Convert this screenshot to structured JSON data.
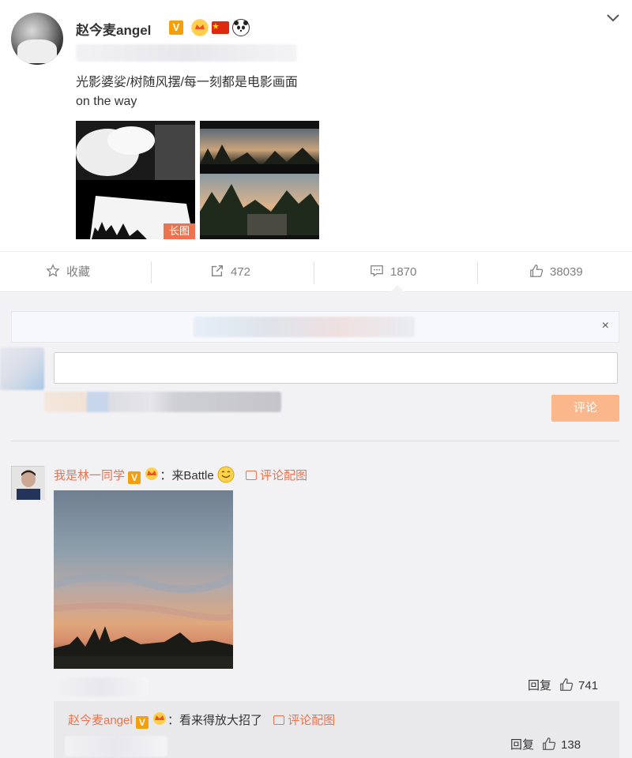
{
  "post": {
    "author": "赵今麦angel",
    "verified_badge": "V",
    "flag_icon": "china-flag-icon",
    "panda_icon": "panda-icon",
    "line1": "光影婆娑/树随风摆/每一刻都是电影画面",
    "line2": "on the way",
    "long_image_tag": "长图",
    "menu_icon": "chevron-down-icon"
  },
  "actions": {
    "favorite_label": "收藏",
    "repost_count": "472",
    "comment_count": "1870",
    "like_count": "38039"
  },
  "comment_box": {
    "close_label": "×",
    "submit_label": "评论"
  },
  "comments": [
    {
      "user": "我是林一同学",
      "badge": "V",
      "text": "：来Battle",
      "pic_link": "评论配图",
      "reply_label": "回复",
      "likes": "741"
    }
  ],
  "reply": {
    "user": "赵今麦angel",
    "badge": "V",
    "text": "：看来得放大招了",
    "pic_link": "评论配图",
    "reply_label": "回复",
    "likes": "138"
  },
  "colors": {
    "accent": "#eb7350",
    "submit_bg": "#fab78b",
    "verified": "#f59f0a",
    "panel_bg": "#f2f2f5"
  }
}
